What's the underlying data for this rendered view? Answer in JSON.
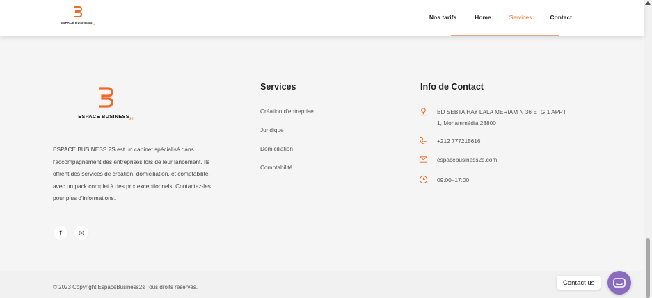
{
  "header": {
    "logo_text": "ESPACE BUSINESS",
    "logo_suffix": "2S",
    "nav": [
      "Nos tarifs",
      "Home",
      "Services",
      "Contact"
    ],
    "active_nav": "Services"
  },
  "footer": {
    "brand": {
      "name": "ESPACE BUSINESS",
      "suffix": "2S"
    },
    "about": "ESPACE BUSINESS 2S est un cabinet spécialisé dans l'accompagnement des entreprises lors de leur lancement. Ils offrent des services de création, domiciliation, et comptabilité, avec un pack complet à des prix exceptionnels. Contactez-les pour plus d'informations.",
    "social": [
      {
        "icon": "facebook-icon",
        "glyph": "f"
      },
      {
        "icon": "instagram-icon",
        "glyph": "◎"
      }
    ],
    "services": {
      "title": "Services",
      "items": [
        "Création d'entreprise",
        "Juridique",
        "Domiciliation",
        "Comptabilité"
      ]
    },
    "contact": {
      "title": "Info de Contact",
      "address": "BD SEBTA HAY LALA MERIAM N 36 ETG 1 APPT 1, Mohammédia 28800",
      "phone": "+212 777215616",
      "email": "espacebusiness2s.com",
      "hours": "09:00–17:00"
    },
    "copyright": "© 2023 Copyright EspaceBusiness2s Tous droits réservés."
  },
  "widget": {
    "label": "Contact us",
    "icon": "chat-icon"
  },
  "colors": {
    "accent": "#f06b2a",
    "chat": "#8a6bbd"
  }
}
